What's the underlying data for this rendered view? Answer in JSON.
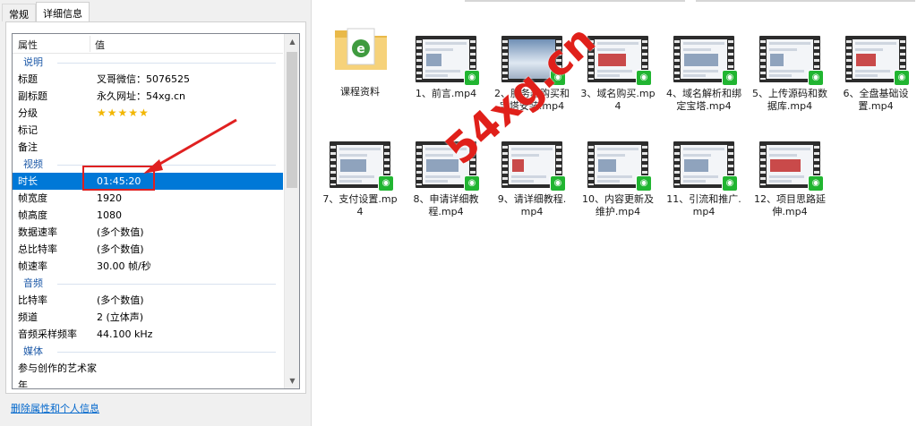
{
  "dialog": {
    "tabs": [
      {
        "label": "常规"
      },
      {
        "label": "详细信息"
      }
    ],
    "columns": {
      "property": "属性",
      "value": "值"
    },
    "rows": [
      {
        "type": "group",
        "key": "说明"
      },
      {
        "type": "item",
        "key": "标题",
        "value": "叉哥微信：5076525"
      },
      {
        "type": "item",
        "key": "副标题",
        "value": "永久网址：54xg.cn"
      },
      {
        "type": "item",
        "key": "分级",
        "value": "★★★★★",
        "rating": 5
      },
      {
        "type": "item",
        "key": "标记",
        "value": ""
      },
      {
        "type": "item",
        "key": "备注",
        "value": ""
      },
      {
        "type": "group",
        "key": "视频"
      },
      {
        "type": "item",
        "key": "时长",
        "value": "01:45:20",
        "selected": true
      },
      {
        "type": "item",
        "key": "帧宽度",
        "value": "1920"
      },
      {
        "type": "item",
        "key": "帧高度",
        "value": "1080"
      },
      {
        "type": "item",
        "key": "数据速率",
        "value": "(多个数值)"
      },
      {
        "type": "item",
        "key": "总比特率",
        "value": "(多个数值)"
      },
      {
        "type": "item",
        "key": "帧速率",
        "value": "30.00 帧/秒"
      },
      {
        "type": "group",
        "key": "音频"
      },
      {
        "type": "item",
        "key": "比特率",
        "value": "(多个数值)"
      },
      {
        "type": "item",
        "key": "频道",
        "value": "2 (立体声)"
      },
      {
        "type": "item",
        "key": "音频采样频率",
        "value": "44.100 kHz"
      },
      {
        "type": "group",
        "key": "媒体"
      },
      {
        "type": "item",
        "key": "参与创作的艺术家",
        "value": ""
      },
      {
        "type": "item",
        "key": "年",
        "value": ""
      }
    ],
    "remove_link": "删除属性和个人信息"
  },
  "explorer": {
    "items": [
      {
        "label": "课程资料",
        "kind": "folder"
      },
      {
        "label": "1、前言.mp4",
        "kind": "video"
      },
      {
        "label": "2、服务器购买和宝塔安装.mp4",
        "kind": "video"
      },
      {
        "label": "3、域名购买.mp4",
        "kind": "video"
      },
      {
        "label": "4、域名解析和绑定宝塔.mp4",
        "kind": "video"
      },
      {
        "label": "5、上传源码和数据库.mp4",
        "kind": "video"
      },
      {
        "label": "6、全盘基础设置.mp4",
        "kind": "video"
      },
      {
        "label": "7、支付设置.mp4",
        "kind": "video"
      },
      {
        "label": "8、申请详细教程.mp4",
        "kind": "video"
      },
      {
        "label": "9、请详细教程.mp4",
        "kind": "video"
      },
      {
        "label": "10、内容更新及维护.mp4",
        "kind": "video"
      },
      {
        "label": "11、引流和推广.mp4",
        "kind": "video"
      },
      {
        "label": "12、项目思路延伸.mp4",
        "kind": "video"
      }
    ],
    "watermark": "54xg.cn"
  },
  "colors": {
    "selection": "#0078d7",
    "group_text": "#1e5aa8",
    "highlight": "#e02020",
    "badge": "#21b531",
    "watermark": "#e0201a"
  }
}
